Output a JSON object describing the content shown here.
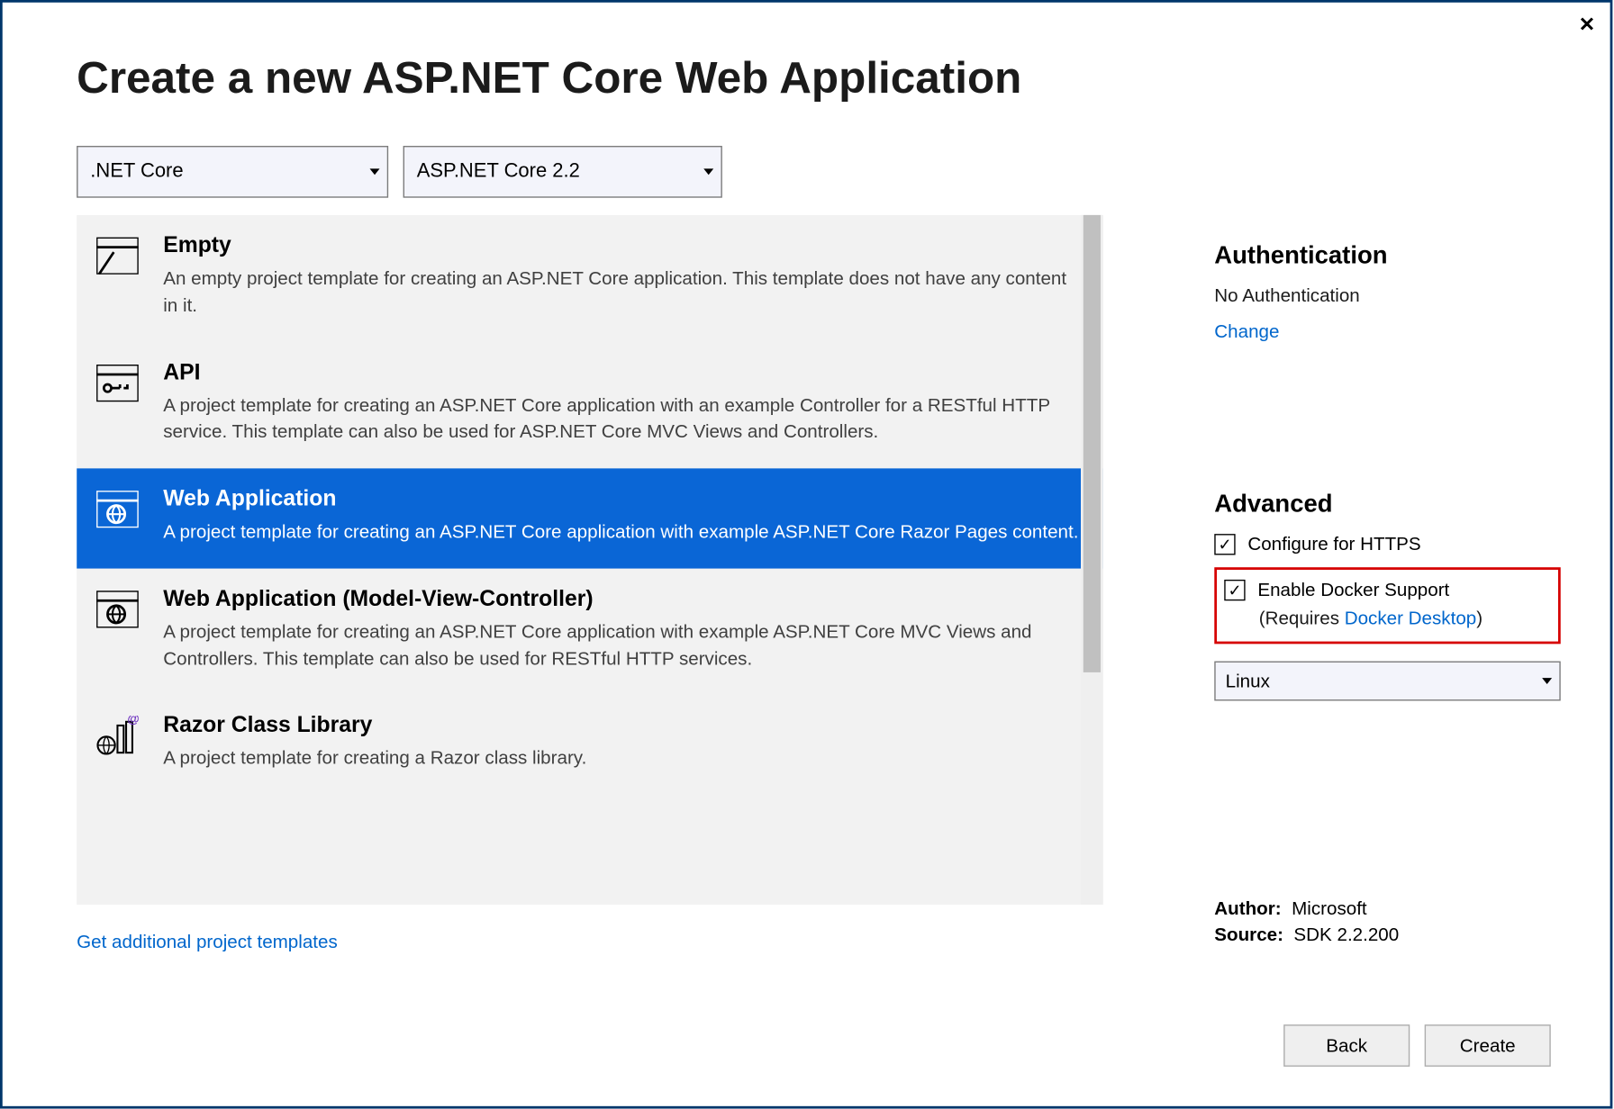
{
  "title": "Create a new ASP.NET Core Web Application",
  "framework_combo": ".NET Core",
  "version_combo": "ASP.NET Core 2.2",
  "templates": [
    {
      "title": "Empty",
      "desc": "An empty project template for creating an ASP.NET Core application. This template does not have any content in it.",
      "icon": "empty"
    },
    {
      "title": "API",
      "desc": "A project template for creating an ASP.NET Core application with an example Controller for a RESTful HTTP service. This template can also be used for ASP.NET Core MVC Views and Controllers.",
      "icon": "api"
    },
    {
      "title": "Web Application",
      "desc": "A project template for creating an ASP.NET Core application with example ASP.NET Core Razor Pages content.",
      "icon": "web",
      "selected": true
    },
    {
      "title": "Web Application (Model-View-Controller)",
      "desc": "A project template for creating an ASP.NET Core application with example ASP.NET Core MVC Views and Controllers. This template can also be used for RESTful HTTP services.",
      "icon": "web"
    },
    {
      "title": "Razor Class Library",
      "desc": "A project template for creating a Razor class library.",
      "icon": "lib"
    }
  ],
  "additional_link": "Get additional project templates",
  "auth": {
    "heading": "Authentication",
    "value": "No Authentication",
    "change": "Change"
  },
  "advanced": {
    "heading": "Advanced",
    "https_label": "Configure for HTTPS",
    "docker_label": "Enable Docker Support",
    "requires_prefix": "(Requires ",
    "requires_link": "Docker Desktop",
    "requires_suffix": ")",
    "os": "Linux"
  },
  "meta": {
    "author_label": "Author:",
    "author": "Microsoft",
    "source_label": "Source:",
    "source": "SDK 2.2.200"
  },
  "buttons": {
    "back": "Back",
    "create": "Create"
  }
}
